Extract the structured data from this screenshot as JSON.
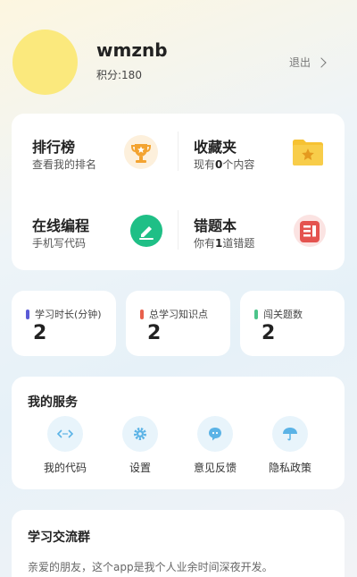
{
  "profile": {
    "username": "wmznb",
    "points": "积分:180",
    "logout": "退出"
  },
  "features": [
    {
      "title": "排行榜",
      "subtitle": "查看我的排名"
    },
    {
      "title": "收藏夹",
      "subtitle_pre": "现有",
      "subtitle_num": "0",
      "subtitle_post": "个内容"
    },
    {
      "title": "在线编程",
      "subtitle": "手机写代码"
    },
    {
      "title": "错题本",
      "subtitle_pre": "你有",
      "subtitle_num": "1",
      "subtitle_post": "道错题"
    }
  ],
  "stats": [
    {
      "label": "学习时长(分钟)",
      "value": "2",
      "color": "#5b5bd6"
    },
    {
      "label": "总学习知识点",
      "value": "2",
      "color": "#e8604c"
    },
    {
      "label": "闯关题数",
      "value": "2",
      "color": "#4cc48a"
    }
  ],
  "services": {
    "title": "我的服务",
    "items": [
      {
        "label": "我的代码",
        "icon": "code-icon"
      },
      {
        "label": "设置",
        "icon": "gear-icon"
      },
      {
        "label": "意见反馈",
        "icon": "chat-icon"
      },
      {
        "label": "隐私政策",
        "icon": "umbrella-icon"
      }
    ]
  },
  "group": {
    "title": "学习交流群",
    "desc": "亲爱的朋友，这个app是我个人业余时间深夜开发。"
  },
  "colors": {
    "accent_blue": "#5bb3e6",
    "avatar": "#fbe97d",
    "trophy": "#f3a330",
    "folder": "#f6c233",
    "edit": "#1fbf86",
    "notebook": "#e4534f"
  }
}
